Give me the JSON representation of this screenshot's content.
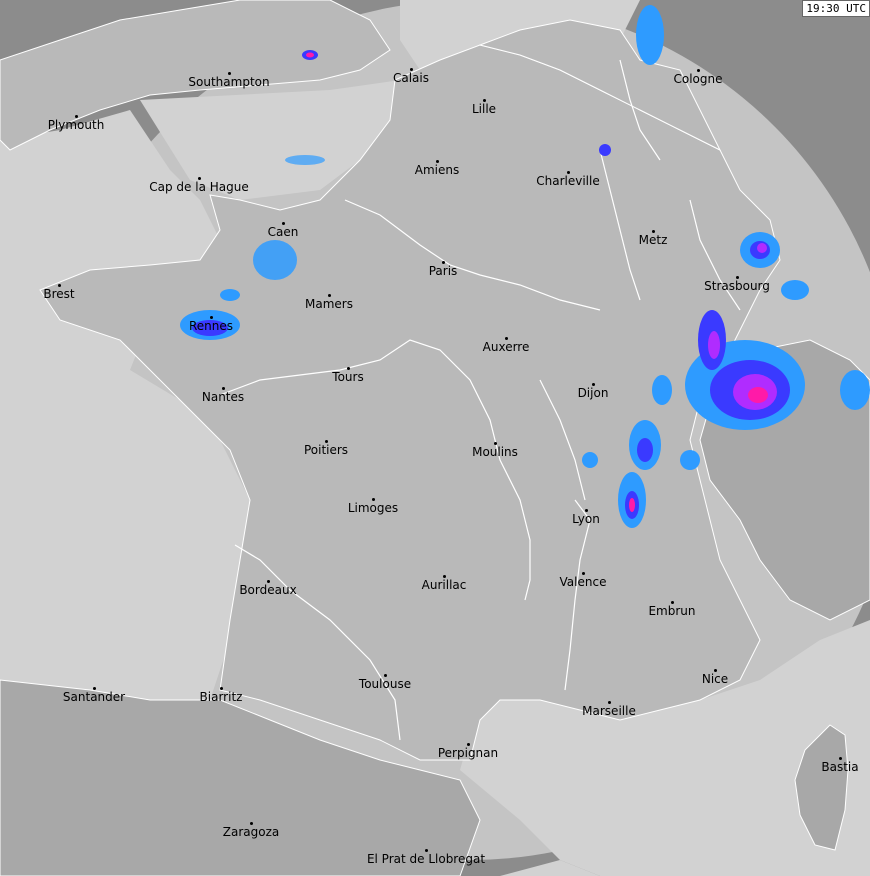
{
  "timestamp": "19:30 UTC",
  "colors": {
    "sea": "#d2d2d2",
    "land_in_coverage": "#b9b9b9",
    "land_out_coverage": "#8c8c8c",
    "coverage_ring": "#c4c4c4",
    "rivers": "#ffffff",
    "rain_light": "#2e9bff",
    "rain_moderate": "#3a3aff",
    "rain_heavy": "#b02cff",
    "rain_extreme": "#ff1aa8"
  },
  "cities": [
    {
      "name": "Southampton"
    },
    {
      "name": "Calais"
    },
    {
      "name": "Cologne"
    },
    {
      "name": "Plymouth"
    },
    {
      "name": "Lille"
    },
    {
      "name": "Amiens"
    },
    {
      "name": "Charleville"
    },
    {
      "name": "Cap de la Hague"
    },
    {
      "name": "Caen"
    },
    {
      "name": "Metz"
    },
    {
      "name": "Paris"
    },
    {
      "name": "Brest"
    },
    {
      "name": "Strasbourg"
    },
    {
      "name": "Mamers"
    },
    {
      "name": "Rennes"
    },
    {
      "name": "Auxerre"
    },
    {
      "name": "Tours"
    },
    {
      "name": "Dijon"
    },
    {
      "name": "Nantes"
    },
    {
      "name": "Poitiers"
    },
    {
      "name": "Moulins"
    },
    {
      "name": "Limoges"
    },
    {
      "name": "Lyon"
    },
    {
      "name": "Valence"
    },
    {
      "name": "Bordeaux"
    },
    {
      "name": "Aurillac"
    },
    {
      "name": "Embrun"
    },
    {
      "name": "Nice"
    },
    {
      "name": "Toulouse"
    },
    {
      "name": "Santander"
    },
    {
      "name": "Biarritz"
    },
    {
      "name": "Marseille"
    },
    {
      "name": "Perpignan"
    },
    {
      "name": "Bastia"
    },
    {
      "name": "Zaragoza"
    },
    {
      "name": "El Prat de Llobregat"
    }
  ]
}
